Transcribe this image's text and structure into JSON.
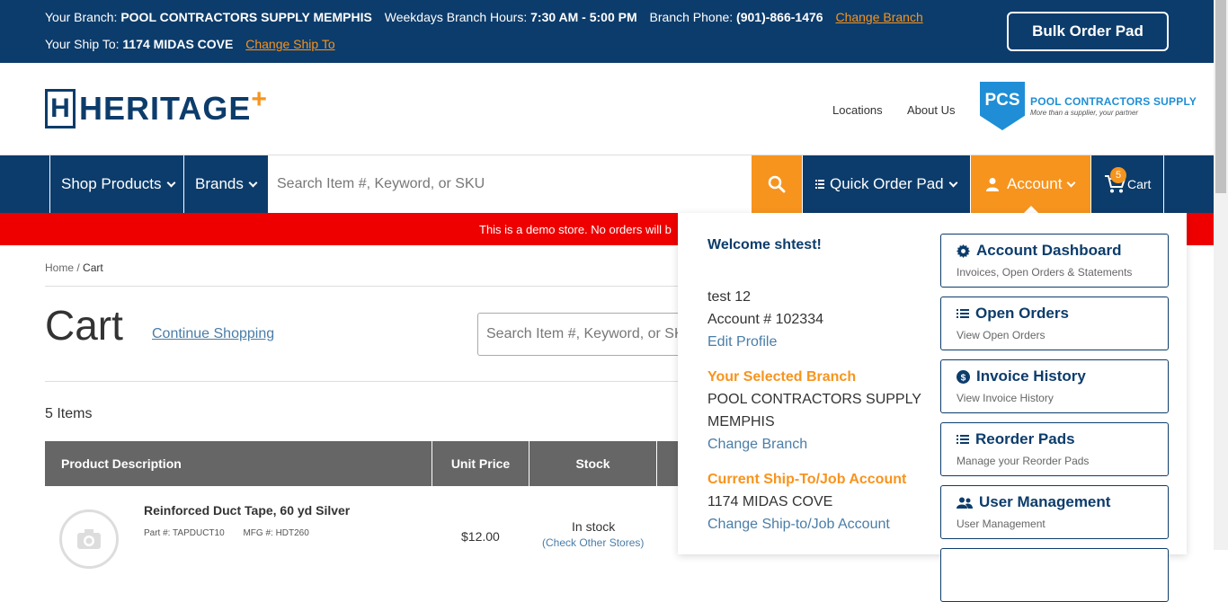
{
  "topbar": {
    "branch_label": "Your Branch:",
    "branch_name": "POOL CONTRACTORS SUPPLY MEMPHIS",
    "hours_label": "Weekdays Branch Hours:",
    "hours_value": "7:30 AM - 5:00 PM",
    "phone_label": "Branch Phone:",
    "phone_value": "(901)-866-1476",
    "change_branch": "Change Branch",
    "shipto_label": "Your Ship To:",
    "shipto_value": "1174 MIDAS COVE",
    "change_shipto": "Change Ship To",
    "bulk_order": "Bulk Order Pad"
  },
  "header": {
    "logo_text": "HERITAGE",
    "logo_mark": "H",
    "logo_plus": "+",
    "links": [
      "Locations",
      "About Us"
    ],
    "partner_mark": "PCS",
    "partner_name": "POOL CONTRACTORS SUPPLY",
    "partner_tagline": "More than a supplier, your partner"
  },
  "nav": {
    "shop_products": "Shop Products",
    "brands": "Brands",
    "search_placeholder": "Search Item #, Keyword, or SKU",
    "quick_order": "Quick Order Pad",
    "account": "Account",
    "cart": "Cart",
    "cart_count": "5"
  },
  "banner": {
    "text": "This is a demo store. No orders will b"
  },
  "main": {
    "breadcrumb_home": "Home",
    "breadcrumb_sep": "/",
    "breadcrumb_current": "Cart",
    "title": "Cart",
    "continue_shopping": "Continue Shopping",
    "search_placeholder": "Search Item #, Keyword, or SKU",
    "items_count": "5 Items",
    "table_headers": [
      "Product Description",
      "Unit Price",
      "Stock"
    ],
    "product": {
      "name": "Reinforced Duct Tape, 60 yd Silver",
      "part": "Part #: TAPDUCT10",
      "mfg": "MFG #: HDT260",
      "price": "$12.00",
      "stock": "In stock",
      "check_stores": "(Check Other Stores)"
    }
  },
  "account_menu": {
    "welcome": "Welcome shtest!",
    "user_name": "test 12",
    "account_number": "Account # 102334",
    "edit_profile": "Edit Profile",
    "selected_branch_heading": "Your Selected Branch",
    "branch_line1": "POOL CONTRACTORS SUPPLY",
    "branch_line2": "MEMPHIS",
    "change_branch": "Change Branch",
    "shipto_heading": "Current Ship-To/Job Account",
    "shipto_value": "1174 MIDAS COVE",
    "change_shipto": "Change Ship-to/Job Account",
    "cards": [
      {
        "title": "Account Dashboard",
        "subtitle": "Invoices, Open Orders & Statements",
        "icon": "gear-icon"
      },
      {
        "title": "Open Orders",
        "subtitle": "View Open Orders",
        "icon": "list-icon"
      },
      {
        "title": "Invoice History",
        "subtitle": "View Invoice History",
        "icon": "dollar-circle-icon"
      },
      {
        "title": "Reorder Pads",
        "subtitle": "Manage your Reorder Pads",
        "icon": "list-icon"
      },
      {
        "title": "User Management",
        "subtitle": "User Management",
        "icon": "users-icon"
      }
    ]
  },
  "colors": {
    "navy": "#0c3c6b",
    "orange": "#f7941e",
    "red": "#ee0000",
    "link": "#4a7da8"
  }
}
